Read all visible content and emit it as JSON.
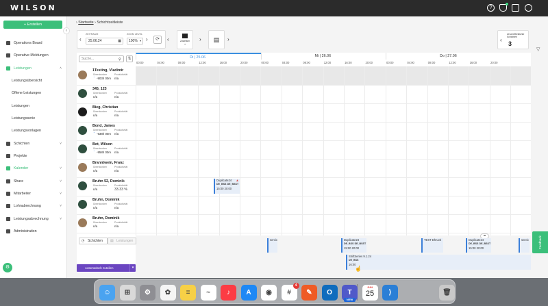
{
  "app": {
    "logo": "WILSON"
  },
  "topbar": {
    "icons": [
      "help-icon",
      "notification-bell-icon",
      "gift-icon",
      "user-account-icon"
    ]
  },
  "sidebar": {
    "create_label": "Erstellen",
    "collapse_glyph": "‹",
    "items": [
      {
        "label": "Operations Board",
        "icon": "dashboard-icon",
        "active": false
      },
      {
        "label": "Operative Meldungen",
        "icon": "report-icon",
        "active": false
      },
      {
        "label": "Leistungen",
        "icon": "services-icon",
        "active": true,
        "chevron": "˄"
      },
      {
        "label": "Leistungsübersicht",
        "sub": true
      },
      {
        "label": "Offene Leistungen",
        "sub": true
      },
      {
        "label": "Leistungen",
        "sub": true
      },
      {
        "label": "Leistungsserie",
        "sub": true
      },
      {
        "label": "Leistungsvorlagen",
        "sub": true
      },
      {
        "label": "Schichten",
        "icon": "clock-icon",
        "chevron": "˅"
      },
      {
        "label": "Projekte",
        "icon": "gear-icon"
      },
      {
        "label": "Kalender",
        "icon": "calendar-icon",
        "chevron": "˅",
        "active": true
      },
      {
        "label": "Share",
        "icon": "share-icon",
        "chevron": "˅"
      },
      {
        "label": "Mitarbeiter",
        "icon": "people-icon",
        "chevron": "˅"
      },
      {
        "label": "Lohnabrechnung",
        "icon": "money-icon",
        "chevron": "˅"
      },
      {
        "label": "Leistungsabrechnung",
        "icon": "invoice-icon",
        "chevron": "˅"
      },
      {
        "label": "Administration",
        "icon": "settings-icon"
      }
    ]
  },
  "breadcrumb": {
    "home": "Startseite",
    "sep": "›",
    "current": "Schichtzeitleiste"
  },
  "toolbar": {
    "period_label": "ZEITRAUM",
    "date_value": "25.06.24",
    "zoom_label": "ZOOM LEVEL",
    "zoom_value": "100%",
    "assign_label": "Zuweisen",
    "unassigned_label": "Unveröffentlichte Schichten",
    "unassigned_count": "3"
  },
  "grid": {
    "search_placeholder": "Suche...",
    "days": [
      {
        "label": "Di | 25.06",
        "today": true
      },
      {
        "label": "Mi | 26.06",
        "today": false
      },
      {
        "label": "Do | 27.06",
        "today": false
      }
    ],
    "hours": [
      "00:00",
      "04:00",
      "08:00",
      "12:00",
      "16:00",
      "20:00"
    ],
    "overtime_label": "Überstunden",
    "productivity_label": "Produktivität",
    "employees": [
      {
        "name": "1Testing, Vladimir",
        "overtime": "-903h 00m",
        "productivity": "n/a",
        "avatar": "photo",
        "trend": true
      },
      {
        "name": "345, 123",
        "overtime": "n/a",
        "productivity": "n/a",
        "avatar": "default"
      },
      {
        "name": "Bieg, Christian",
        "overtime": "n/a",
        "productivity": "n/a",
        "avatar": "dark"
      },
      {
        "name": "Bond, James",
        "overtime": "-938h 00m",
        "productivity": "n/a",
        "avatar": "default",
        "trend": true
      },
      {
        "name": "Bot, Wilson",
        "overtime": "-958h 00m",
        "productivity": "n/a",
        "avatar": "default",
        "trend": true
      },
      {
        "name": "Branntwein, Franz",
        "overtime": "n/a",
        "productivity": "n/a",
        "avatar": "photo"
      },
      {
        "name": "Bruhn 52, Dominik",
        "overtime": "n/a",
        "productivity": "33.33 %",
        "avatar": "default"
      },
      {
        "name": "Bruhn, Dominik",
        "overtime": "n/a",
        "productivity": "n/a",
        "avatar": "default"
      },
      {
        "name": "Bruhn, Dominik",
        "overtime": "n/a",
        "productivity": "n/a",
        "avatar": "photo"
      }
    ],
    "shift": {
      "title": "Duplicate24",
      "code1": "DE_BSS",
      "code2": "DE_BSST",
      "start": "15:00",
      "end": "20:00"
    }
  },
  "bottom": {
    "tab_shifts": "Schichten",
    "tab_services": "Leistungen",
    "auto_assign": "Automatisch zuteilen",
    "cards": [
      {
        "title": "servic"
      },
      {
        "title": "Duplicate24",
        "code1": "DE_BSS",
        "code2": "DE_BSST",
        "start": "15:00",
        "end": "20:00"
      },
      {
        "title": "TEST Dhruvit"
      },
      {
        "title": "Duplicate24",
        "code1": "DE_BSS",
        "code2": "DE_BSST",
        "start": "15:00",
        "end": "20:00"
      },
      {
        "title": "servic"
      }
    ],
    "series": {
      "title": "ShiftSeries 9.1.24",
      "code": "DE_BSS",
      "start": "16:00"
    },
    "eq_glyph": "="
  },
  "feedback": "Feedback",
  "dock": {
    "apps": [
      "finder-icon",
      "launchpad-icon",
      "settings-icon",
      "photos-icon",
      "notes-icon",
      "freeform-icon",
      "music-icon",
      "appstore-icon",
      "chrome-icon",
      "slack-icon",
      "postman-icon",
      "outlook-icon",
      "teams-icon",
      "calendar-icon",
      "vscode-icon",
      "trash-icon"
    ],
    "slack_badge": "4",
    "teams_badge": "NEW",
    "calendar_month": "JUN",
    "calendar_day": "25"
  },
  "colors": {
    "brand_green": "#3bbf7a",
    "today_blue": "#3b8fe0",
    "auto_purple": "#6b46c1"
  }
}
